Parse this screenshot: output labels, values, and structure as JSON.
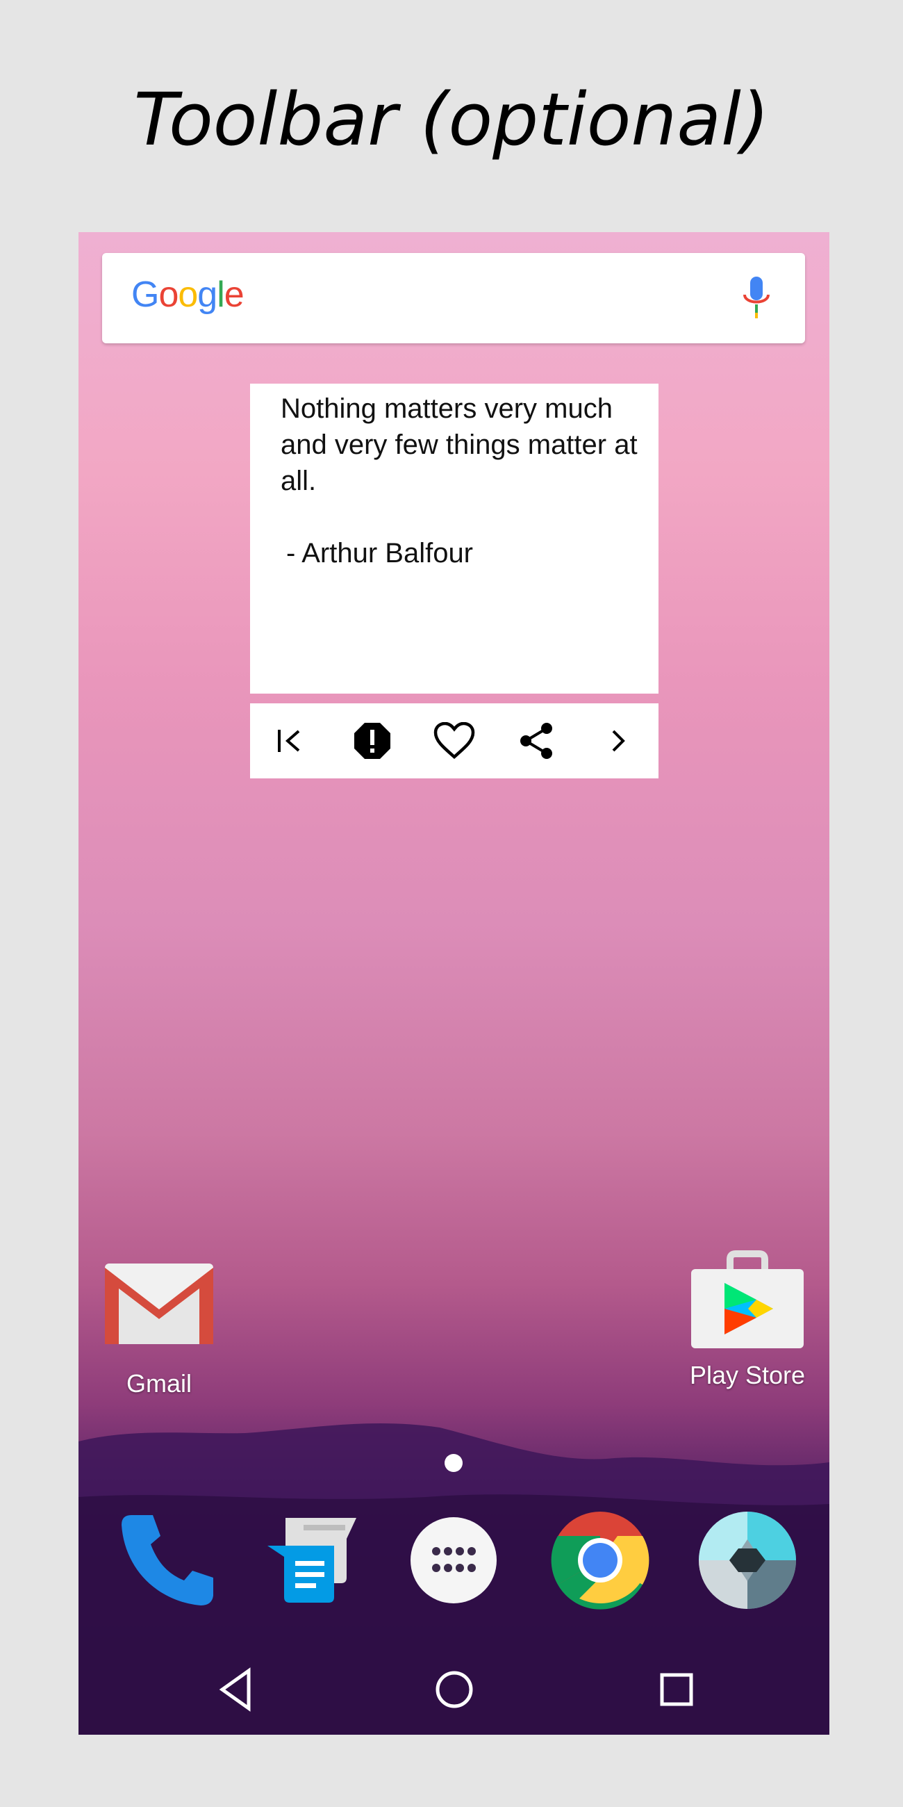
{
  "caption": "Toolbar (optional)",
  "search": {
    "logo_text": "Google",
    "logo_colors": [
      "#4285F4",
      "#EA4335",
      "#FBBC05",
      "#4285F4",
      "#34A853",
      "#EA4335"
    ]
  },
  "quote_widget": {
    "quote": "Nothing matters very much and very few things matter at all.",
    "author": "- Arthur Balfour",
    "toolbar_buttons": [
      "first-icon",
      "report-icon",
      "heart-icon",
      "share-icon",
      "next-icon"
    ]
  },
  "apps": {
    "gmail": "Gmail",
    "play_store": "Play Store"
  },
  "dock": [
    "phone-icon",
    "messages-icon",
    "app-drawer-icon",
    "chrome-icon",
    "camera-icon"
  ],
  "navbar": [
    "back-icon",
    "home-icon",
    "recents-icon"
  ]
}
